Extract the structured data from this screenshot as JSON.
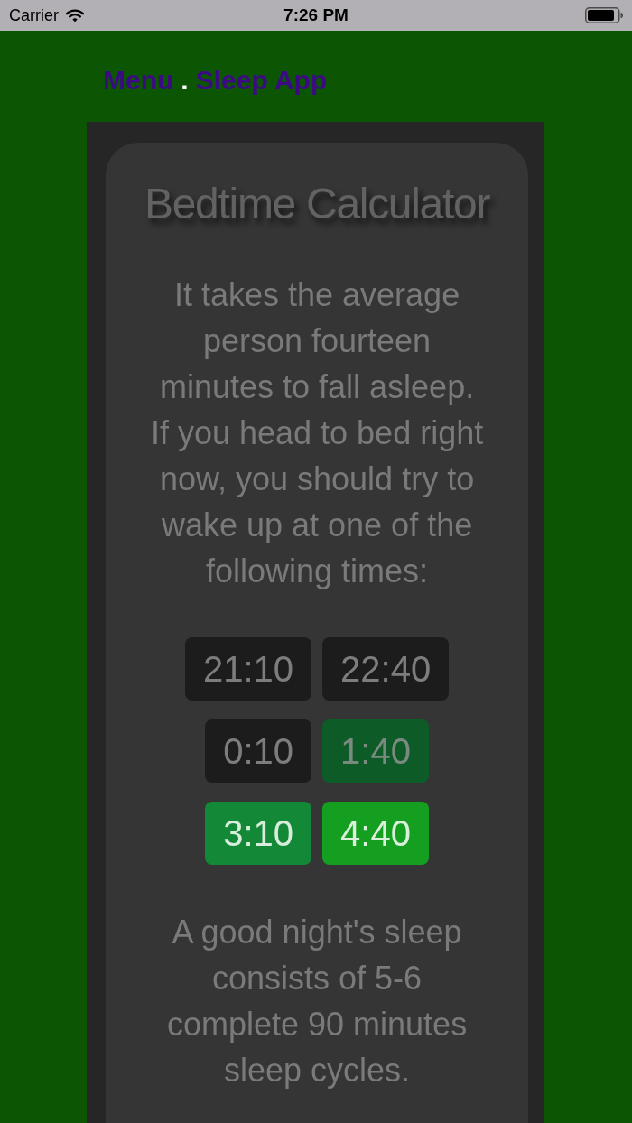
{
  "status_bar": {
    "carrier": "Carrier",
    "time": "7:26 PM"
  },
  "nav": {
    "menu": "Menu",
    "separator": ".",
    "title": "Sleep App"
  },
  "card": {
    "title": "Bedtime Calculator",
    "intro": [
      "It takes the average person fourteen minutes to fall asleep.",
      "If you head to bed right now, you should try to wake up at one of the following times:"
    ],
    "times": [
      {
        "label": "21:10",
        "color": "#1c1c1c"
      },
      {
        "label": "22:40",
        "color": "#1c1c1c"
      },
      {
        "label": "0:10",
        "color": "#1c1c1c"
      },
      {
        "label": "1:40",
        "color": "#0d5c28"
      },
      {
        "label": "3:10",
        "color": "#138937"
      },
      {
        "label": "4:40",
        "color": "#159f21"
      }
    ],
    "footer": "A good night's sleep consists of 5-6 complete 90 minutes sleep cycles."
  }
}
